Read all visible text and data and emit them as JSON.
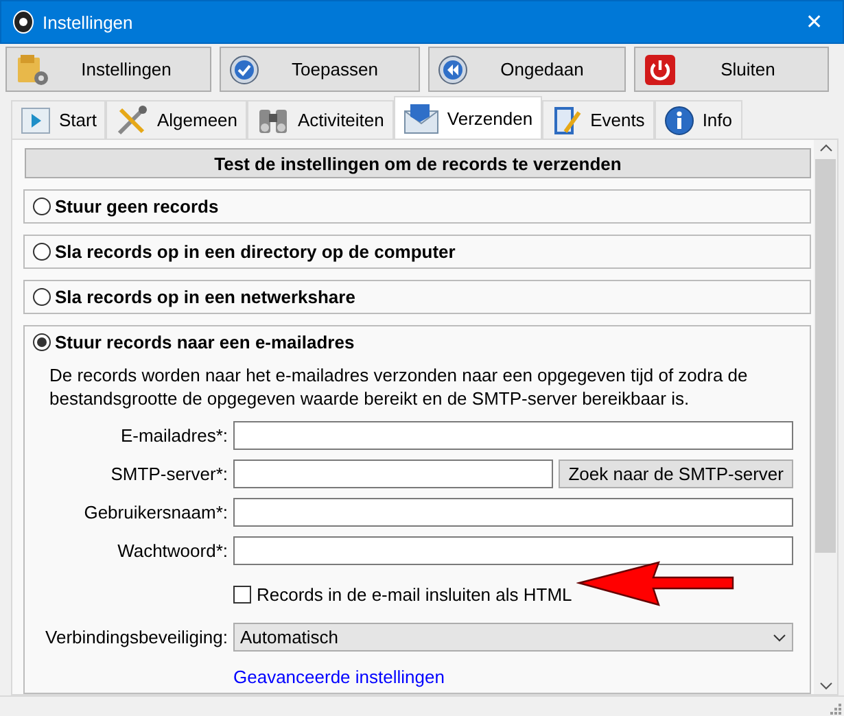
{
  "window": {
    "title": "Instellingen",
    "close": "✕"
  },
  "toolbar": [
    {
      "label": "Instellingen"
    },
    {
      "label": "Toepassen"
    },
    {
      "label": "Ongedaan"
    },
    {
      "label": "Sluiten"
    }
  ],
  "tabs": [
    {
      "label": "Start",
      "selected": false
    },
    {
      "label": "Algemeen",
      "selected": false
    },
    {
      "label": "Activiteiten",
      "selected": false
    },
    {
      "label": "Verzenden",
      "selected": true
    },
    {
      "label": "Events",
      "selected": false
    },
    {
      "label": "Info",
      "selected": false
    }
  ],
  "test_button": "Test de instellingen om de records te verzenden",
  "options": [
    {
      "label": "Stuur geen records",
      "selected": false
    },
    {
      "label": "Sla records op in een directory op de computer",
      "selected": false
    },
    {
      "label": "Sla records op in een netwerkshare",
      "selected": false
    },
    {
      "label": "Stuur records naar een e-mailadres",
      "selected": true,
      "description": "De records worden naar het e-mailadres verzonden naar een opgegeven tijd of zodra de bestandsgrootte de opgegeven waarde bereikt en de SMTP-server bereikbaar is.",
      "form": [
        {
          "kind": "text",
          "label": "E-mailadres*:"
        },
        {
          "kind": "text_button",
          "label": "SMTP-server*:",
          "button": "Zoek naar de SMTP-server"
        },
        {
          "kind": "text",
          "label": "Gebruikersnaam*:"
        },
        {
          "kind": "password",
          "label": "Wachtwoord*:"
        },
        {
          "kind": "checkbox",
          "label": "Records in de e-mail insluiten als HTML",
          "checked": false
        },
        {
          "kind": "dropdown",
          "label": "Verbindingsbeveiliging:",
          "value": "Automatisch"
        },
        {
          "kind": "link",
          "label": "Geavanceerde instellingen"
        }
      ]
    }
  ]
}
